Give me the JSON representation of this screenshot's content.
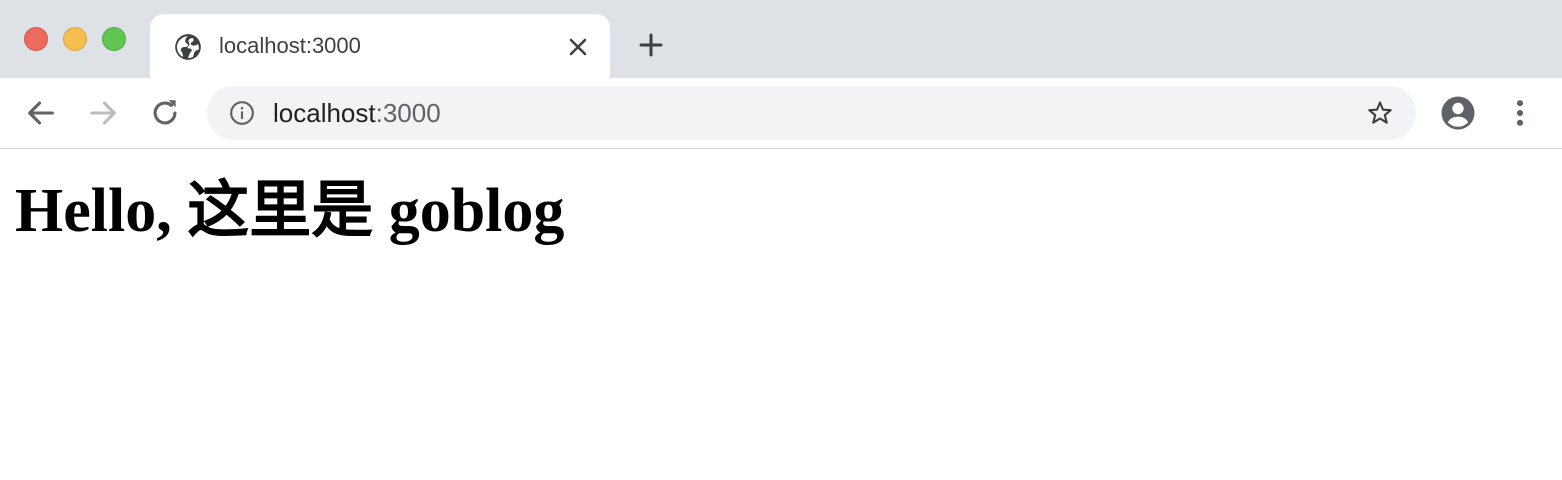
{
  "window": {
    "traffic_lights": {
      "close_color": "#ed6a5e",
      "minimize_color": "#f4bf4f",
      "maximize_color": "#61c554"
    }
  },
  "tab": {
    "title": "localhost:3000",
    "favicon": "globe-icon",
    "close_icon": "close-icon"
  },
  "new_tab": {
    "icon": "plus-icon"
  },
  "toolbar": {
    "back_icon": "arrow-left-icon",
    "forward_icon": "arrow-right-icon",
    "reload_icon": "reload-icon",
    "bookmark_icon": "star-icon",
    "profile_icon": "account-circle-icon",
    "menu_icon": "more-vertical-icon"
  },
  "omnibox": {
    "security_icon": "info-icon",
    "url_host": "localhost",
    "url_port": ":3000"
  },
  "page": {
    "heading": "Hello, 这里是 goblog"
  }
}
